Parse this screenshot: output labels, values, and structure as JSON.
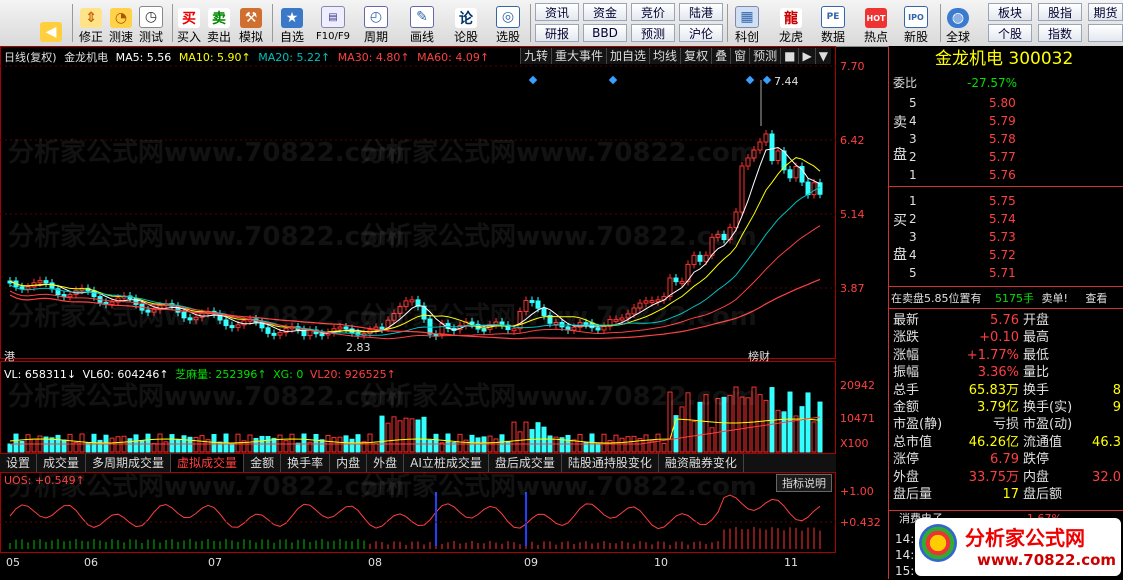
{
  "toolbar": {
    "buttons": [
      {
        "label": "",
        "icon": "back-arrow-icon"
      },
      {
        "label": "修正",
        "icon": "updown-icon"
      },
      {
        "label": "测速",
        "icon": "speed-icon"
      },
      {
        "label": "测试",
        "icon": "clock-icon"
      },
      {
        "label": "买入",
        "icon": "buy-icon",
        "glyph": "买"
      },
      {
        "label": "卖出",
        "icon": "sell-icon",
        "glyph": "卖"
      },
      {
        "label": "模拟",
        "icon": "hammer-icon"
      },
      {
        "label": "自选",
        "icon": "star-icon"
      },
      {
        "label": "F10/F9",
        "icon": "f10-icon"
      },
      {
        "label": "周期",
        "icon": "cycle-icon"
      },
      {
        "label": "画线",
        "icon": "pen-icon"
      },
      {
        "label": "论股",
        "icon": "discuss-icon",
        "glyph": "论"
      },
      {
        "label": "选股",
        "icon": "select-stock-icon"
      },
      {
        "label": "科创",
        "icon": "star-market-icon"
      },
      {
        "label": "龙虎",
        "icon": "dragon-tiger-icon"
      },
      {
        "label": "数据",
        "icon": "pe-data-icon",
        "glyph": "PE"
      },
      {
        "label": "热点",
        "icon": "hot-icon",
        "glyph": "HOT"
      },
      {
        "label": "新股",
        "icon": "ipo-icon",
        "glyph": "IPO"
      },
      {
        "label": "全球",
        "icon": "globe-icon"
      }
    ],
    "text_buttons": [
      "资讯",
      "资金",
      "竞价",
      "陆港",
      "研报",
      "BBD",
      "预测",
      "沪伦",
      "板块",
      "股指",
      "期货",
      "个股",
      "指数"
    ]
  },
  "stock": {
    "name": "金龙机电",
    "code": "300032"
  },
  "header_line": {
    "period": "日线(复权)",
    "name": "金龙机电",
    "ma5": "MA5: 5.56",
    "ma10": "MA10: 5.90↑",
    "ma20": "MA20: 5.22↑",
    "ma30": "MA30: 4.80↑",
    "ma60": "MA60: 4.09↑"
  },
  "top_strip": [
    "九转",
    "重大事件",
    "加自选",
    "均线",
    "复权",
    "叠",
    "窗",
    "预测",
    "■",
    "▶",
    "▼"
  ],
  "price_axis": [
    "7.70",
    "6.42",
    "5.14",
    "3.87"
  ],
  "chart_labels": {
    "high": "7.44",
    "low": "2.83",
    "left_tag": "港",
    "event_tag": "榜财"
  },
  "volume_header": {
    "vl": "VL: 658311↓",
    "vl60": "VL60: 604246↑",
    "zhima": "芝麻量: 252396↑",
    "xg": "XG: 0",
    "vl20": "VL20: 926525↑"
  },
  "volume_axis": [
    "20942",
    "10471",
    "X100"
  ],
  "indicator_tabs": [
    "设置",
    "成交量",
    "多周期成交量",
    "虚拟成交量",
    "金额",
    "换手率",
    "内盘",
    "外盘",
    "AI立桩成交量",
    "盘后成交量",
    "陆股通持股变化",
    "融资融券变化"
  ],
  "indicator_active": "虚拟成交量",
  "indicator_help": "指标说明",
  "uos": {
    "label": "UOS: +0.549↑",
    "axis": [
      "+1.00",
      "+0.432"
    ]
  },
  "months": [
    "05",
    "06",
    "07",
    "08",
    "09",
    "10",
    "11"
  ],
  "panel": {
    "title": "金龙机电 300032",
    "weibi_label": "委比",
    "weibi": "-27.57%",
    "sell_label": [
      "卖",
      "盘"
    ],
    "buy_label": [
      "买",
      "盘"
    ],
    "asks": [
      {
        "lvl": "5",
        "price": "5.80"
      },
      {
        "lvl": "4",
        "price": "5.79"
      },
      {
        "lvl": "3",
        "price": "5.78"
      },
      {
        "lvl": "2",
        "price": "5.77"
      },
      {
        "lvl": "1",
        "price": "5.76"
      }
    ],
    "bids": [
      {
        "lvl": "1",
        "price": "5.75"
      },
      {
        "lvl": "2",
        "price": "5.74"
      },
      {
        "lvl": "3",
        "price": "5.73"
      },
      {
        "lvl": "4",
        "price": "5.72"
      },
      {
        "lvl": "5",
        "price": "5.71"
      }
    ],
    "notice": "在卖盘5.85位置有",
    "notice_qty": "5175手",
    "notice_type": "卖单!",
    "notice_link": "查看",
    "stats": [
      {
        "l": "最新",
        "v": "5.76",
        "r": "开盘",
        "c": "red"
      },
      {
        "l": "涨跌",
        "v": "+0.10",
        "r": "最高",
        "c": "red"
      },
      {
        "l": "涨幅",
        "v": "+1.77%",
        "r": "最低",
        "c": "red"
      },
      {
        "l": "振幅",
        "v": "3.36%",
        "r": "量比",
        "c": "red"
      },
      {
        "l": "总手",
        "v": "65.83万",
        "r": "换手",
        "c": "yellow",
        "rv": "8"
      },
      {
        "l": "金额",
        "v": "3.79亿",
        "r": "换手(实)",
        "c": "yellow",
        "rv": "9"
      },
      {
        "l": "市盈(静)",
        "v": "亏损",
        "r": "市盈(动)",
        "c": "white"
      },
      {
        "l": "总市值",
        "v": "46.26亿",
        "r": "流通值",
        "c": "yellow",
        "rv": "46.3"
      },
      {
        "l": "涨停",
        "v": "6.79",
        "r": "跌停",
        "c": "red"
      },
      {
        "l": "外盘",
        "v": "33.75万",
        "r": "内盘",
        "c": "red",
        "rv": "32.0"
      },
      {
        "l": "盘后量",
        "v": "17",
        "r": "盘后额",
        "c": "yellow"
      }
    ],
    "sector": "消费电子",
    "sector_pct": "1.67%",
    "bottom_times": [
      "14:",
      "14:",
      "15:"
    ],
    "logo_text": "分析家公式网",
    "logo_url": "www.70822.com"
  },
  "watermark": "分析家公式网www.70822.com"
}
